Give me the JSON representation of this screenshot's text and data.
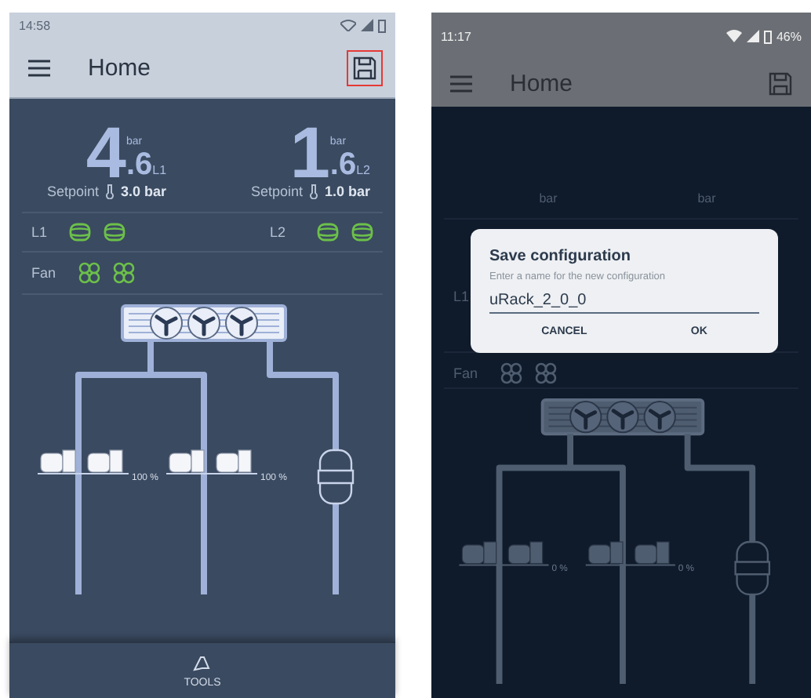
{
  "phones": [
    {
      "dimmed": false,
      "status_bar": {
        "time": "14:58"
      },
      "app_bar": {
        "title": "Home",
        "save_highlighted": true
      },
      "gauges": [
        {
          "value": "4",
          "decimal": ".6",
          "unit": "bar",
          "line": "L1",
          "setpoint_label": "Setpoint",
          "setpoint": "3.0 bar"
        },
        {
          "value": "1",
          "decimal": ".6",
          "unit": "bar",
          "line": "L2",
          "setpoint_label": "Setpoint",
          "setpoint": "1.0 bar"
        }
      ],
      "lines": [
        {
          "label": "L1",
          "tanks": [
            {
              "on": true
            },
            {
              "on": true
            }
          ]
        },
        {
          "label": "L2",
          "tanks": [
            {
              "on": true
            },
            {
              "on": true
            }
          ]
        }
      ],
      "fan": {
        "label": "Fan",
        "fans": [
          {
            "on": true
          },
          {
            "on": true
          }
        ]
      },
      "compressor_groups": [
        {
          "reading": "100 %"
        },
        {
          "reading": "100 %"
        }
      ],
      "bottom_nav": {
        "label": "TOOLS"
      }
    },
    {
      "dimmed": true,
      "status_bar": {
        "time": "11:17",
        "battery": "46%"
      },
      "app_bar": {
        "title": "Home",
        "save_highlighted": false
      },
      "gauges": [
        {
          "unit": "bar"
        },
        {
          "unit": "bar"
        }
      ],
      "lines": [
        {
          "label": "L1"
        }
      ],
      "fan": {
        "label": "Fan",
        "fans": [
          {
            "on": false
          },
          {
            "on": false
          }
        ]
      },
      "compressor_groups": [
        {
          "reading": "0 %"
        },
        {
          "reading": "0 %"
        }
      ],
      "dialog": {
        "title": "Save configuration",
        "message": "Enter a name for the new configuration",
        "value": "uRack_2_0_0",
        "buttons": [
          "CANCEL",
          "OK"
        ]
      }
    }
  ]
}
